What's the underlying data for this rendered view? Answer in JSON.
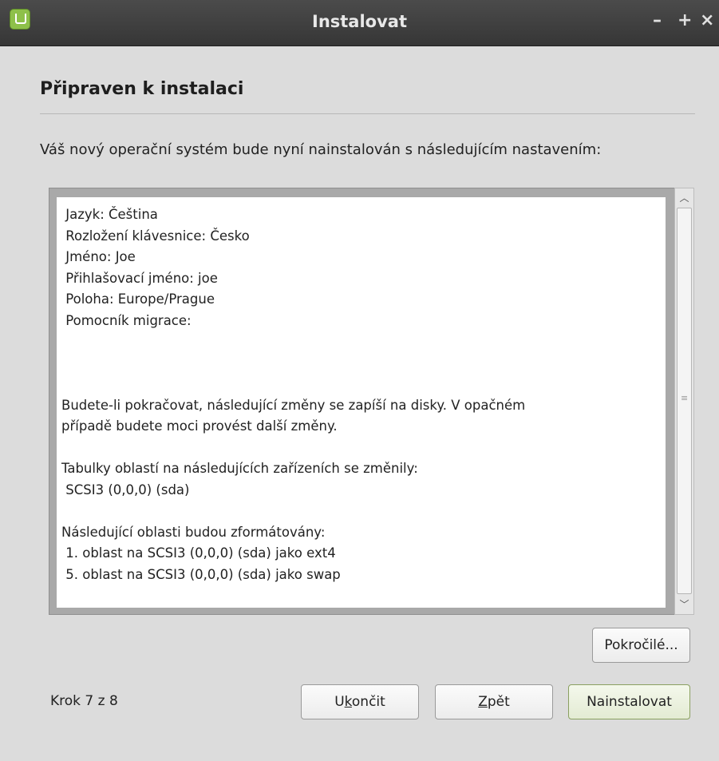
{
  "window": {
    "title": "Instalovat",
    "controls": {
      "minimize": "–",
      "maximize": "+",
      "close": "×"
    },
    "icon": "linux-mint-logo-icon"
  },
  "page": {
    "heading": "Připraven k instalaci",
    "intro": "Váš nový operační systém bude nyní nainstalován s následujícím nastavením:"
  },
  "summary": {
    "lines": [
      " Jazyk: Čeština",
      " Rozložení klávesnice: Česko",
      " Jméno: Joe",
      " Přihlašovací jméno: joe",
      " Poloha: Europe/Prague",
      " Pomocník migrace:",
      "",
      "",
      "",
      "Budete-li pokračovat, následující změny se zapíší na disky. V opačném",
      "případě budete moci provést další změny.",
      "",
      "Tabulky oblastí na následujících zařízeních se změnily:",
      " SCSI3 (0,0,0) (sda)",
      "",
      "Následující oblasti budou zformátovány:",
      " 1. oblast na SCSI3 (0,0,0) (sda) jako ext4",
      " 5. oblast na SCSI3 (0,0,0) (sda) jako swap"
    ]
  },
  "buttons": {
    "advanced": "Pokročilé...",
    "quit_pre": "U",
    "quit_mnemonic": "k",
    "quit_post": "ončit",
    "back_mnemonic": "Z",
    "back_post": "pět",
    "install": "Nainstalovat"
  },
  "status": {
    "step": "Krok 7 z 8"
  },
  "colors": {
    "titlebar": "#3f3f3f",
    "window_bg": "#dcdcdc",
    "accent": "#8ec04a"
  }
}
